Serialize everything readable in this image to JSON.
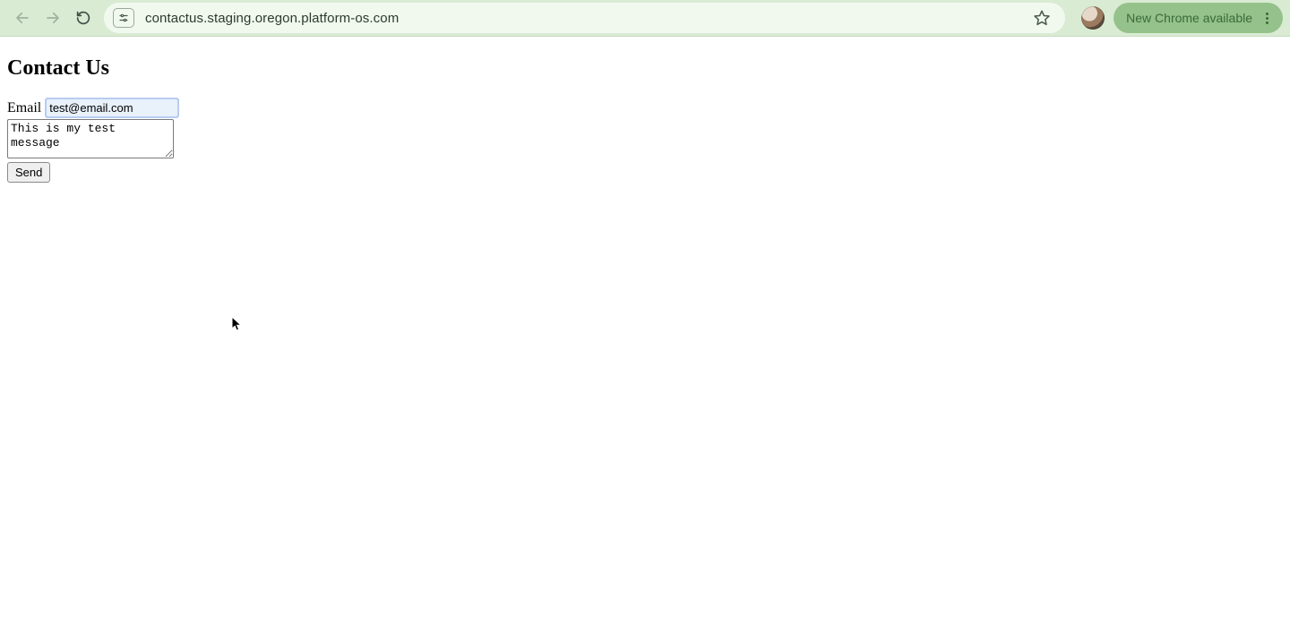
{
  "browser": {
    "url": "contactus.staging.oregon.platform-os.com",
    "update_label": "New Chrome available"
  },
  "page": {
    "title": "Contact Us",
    "email_label": "Email",
    "email_value": "test@email.com",
    "message_value": "This is my test message",
    "send_label": "Send"
  }
}
